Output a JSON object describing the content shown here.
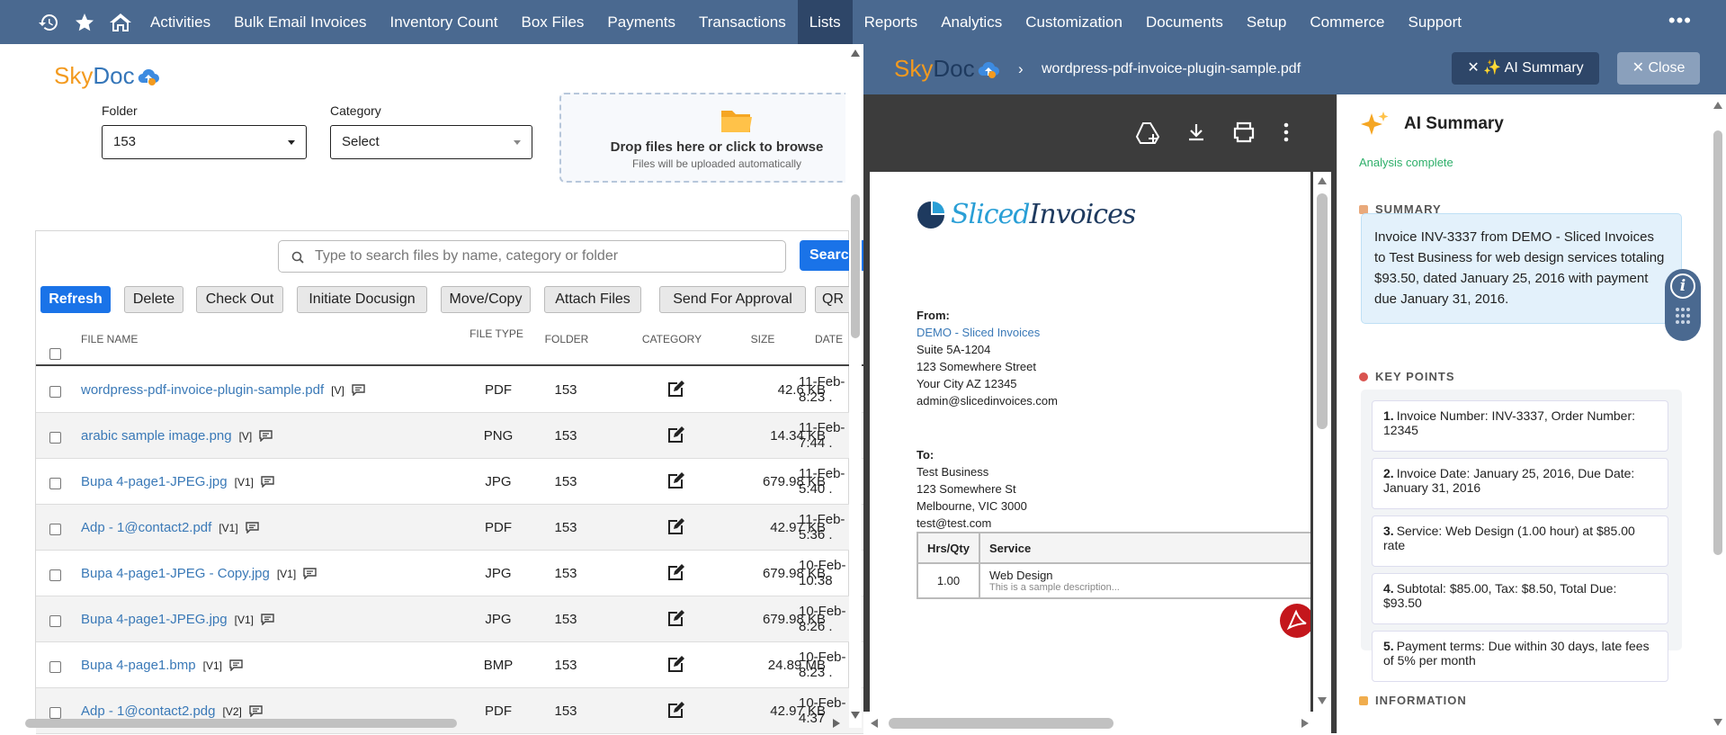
{
  "nav": {
    "items": [
      "Activities",
      "Bulk Email Invoices",
      "Inventory Count",
      "Box Files",
      "Payments",
      "Transactions",
      "Lists",
      "Reports",
      "Analytics",
      "Customization",
      "Documents",
      "Setup",
      "Commerce",
      "Support"
    ],
    "active": "Lists",
    "more": "•••"
  },
  "brand": {
    "sky": "Sky",
    "doc": "Doc"
  },
  "filters": {
    "folder_label": "Folder",
    "folder_value": "153",
    "category_label": "Category",
    "category_value": "Select"
  },
  "dropzone": {
    "title": "Drop files here or click to browse",
    "subtitle": "Files will be uploaded automatically"
  },
  "search": {
    "placeholder": "Type to search files by name, category or folder",
    "button": "Search"
  },
  "toolbar": [
    "Refresh",
    "Delete",
    "Check Out",
    "Initiate Docusign",
    "Move/Copy",
    "Attach Files",
    "Send For Approval",
    "QR"
  ],
  "table": {
    "headers": {
      "name": "FILE NAME",
      "type": "FILE TYPE",
      "folder": "FOLDER",
      "category": "CATEGORY",
      "size": "SIZE",
      "date": "DATE"
    },
    "rows": [
      {
        "name": "wordpress-pdf-invoice-plugin-sample.pdf",
        "ver": "[V]",
        "type": "PDF",
        "folder": "153",
        "size": "42.6 KB",
        "date1": "11-Feb-",
        "date2": "8:23 ."
      },
      {
        "name": "arabic sample image.png",
        "ver": "[V]",
        "type": "PNG",
        "folder": "153",
        "size": "14.34 KB",
        "date1": "11-Feb-",
        "date2": "7:44 ."
      },
      {
        "name": "Bupa 4-page1-JPEG.jpg",
        "ver": "[V1]",
        "type": "JPG",
        "folder": "153",
        "size": "679.98 KB",
        "date1": "11-Feb-",
        "date2": "5:40 ."
      },
      {
        "name": "Adp - 1@contact2.pdf",
        "ver": "[V1]",
        "type": "PDF",
        "folder": "153",
        "size": "42.97 KB",
        "date1": "11-Feb-",
        "date2": "5:36 ."
      },
      {
        "name": "Bupa 4-page1-JPEG - Copy.jpg",
        "ver": "[V1]",
        "type": "JPG",
        "folder": "153",
        "size": "679.98 KB",
        "date1": "10-Feb-",
        "date2": "10:38"
      },
      {
        "name": "Bupa 4-page1-JPEG.jpg",
        "ver": "[V1]",
        "type": "JPG",
        "folder": "153",
        "size": "679.98 KB",
        "date1": "10-Feb-",
        "date2": "8:26 ."
      },
      {
        "name": "Bupa 4-page1.bmp",
        "ver": "[V1]",
        "type": "BMP",
        "folder": "153",
        "size": "24.89 MB",
        "date1": "10-Feb-",
        "date2": "8:23 ."
      },
      {
        "name": "Adp - 1@contact2.pdg",
        "ver": "[V2]",
        "type": "PDF",
        "folder": "153",
        "size": "42.97 KB",
        "date1": "10-Feb-",
        "date2": "4:37"
      }
    ]
  },
  "preview": {
    "breadcrumb_chevron": "›",
    "filename": "wordpress-pdf-invoice-plugin-sample.pdf",
    "ai_button": "✕ ✨ AI Summary",
    "close_button": "✕ Close"
  },
  "invoice": {
    "brand_a": "Sliced",
    "brand_b": "Invoices",
    "from_label": "From:",
    "from_lines": [
      "DEMO - Sliced Invoices",
      "Suite 5A-1204",
      "123 Somewhere Street",
      "Your City AZ 12345",
      "admin@slicedinvoices.com"
    ],
    "to_label": "To:",
    "to_lines": [
      "Test Business",
      "123 Somewhere St",
      "Melbourne, VIC 3000",
      "test@test.com"
    ],
    "table_headers": [
      "Hrs/Qty",
      "Service"
    ],
    "row_qty": "1.00",
    "row_service": "Web Design",
    "row_desc": "This is a sample description..."
  },
  "ai": {
    "title": "AI Summary",
    "status": "Analysis complete",
    "summary_head": "SUMMARY",
    "summary": "Invoice INV-3337 from DEMO - Sliced Invoices to Test Business for web design services totaling $93.50, dated January 25, 2016 with payment due January 31, 2016.",
    "keypoints_head": "KEY POINTS",
    "keypoints": [
      {
        "n": "1.",
        "text": "Invoice Number: INV-3337, Order Number: 12345"
      },
      {
        "n": "2.",
        "text": "Invoice Date: January 25, 2016, Due Date: January 31, 2016"
      },
      {
        "n": "3.",
        "text": "Service: Web Design (1.00 hour) at $85.00 rate"
      },
      {
        "n": "4.",
        "text": "Subtotal: $85.00, Tax: $8.50, Total Due: $93.50"
      },
      {
        "n": "5.",
        "text": "Payment terms: Due within 30 days, late fees of 5% per month"
      }
    ],
    "information_head": "INFORMATION"
  },
  "colors": {
    "nav": "#4a6990",
    "nav_active": "#2e4668",
    "primary": "#1a73e8",
    "link": "#3a79b7",
    "success": "#2eaf6a"
  }
}
